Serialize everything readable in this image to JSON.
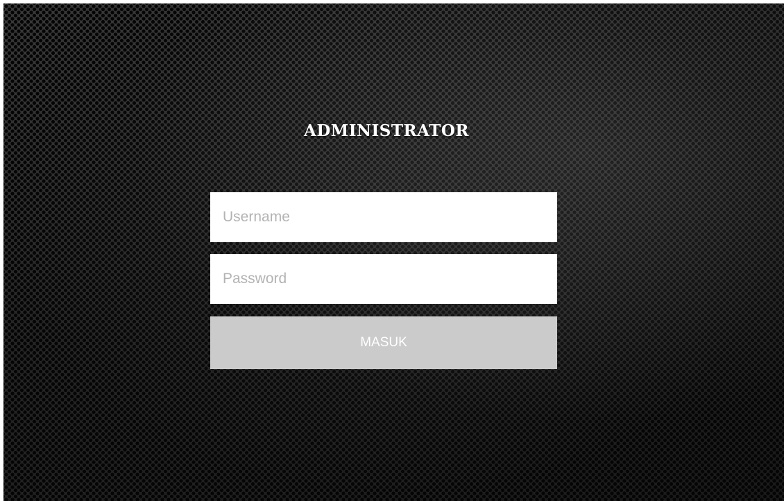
{
  "login": {
    "title": "ADMINISTRATOR",
    "username_placeholder": "Username",
    "password_placeholder": "Password",
    "submit_label": "MASUK"
  },
  "colors": {
    "background": "#1c1c1c",
    "title_text": "#ffffff",
    "field_background": "#ffffff",
    "placeholder_text": "#b3b3b3",
    "button_background": "#cbcbcb",
    "button_text": "#ffffff"
  }
}
